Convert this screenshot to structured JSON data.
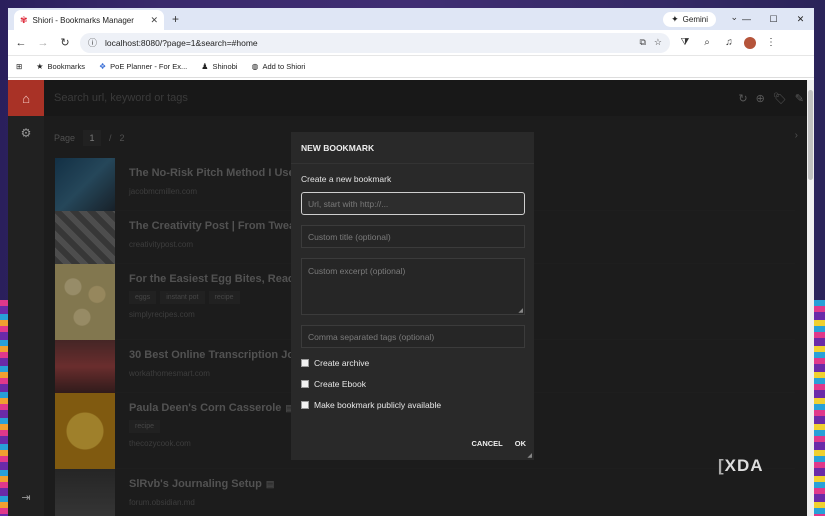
{
  "browser": {
    "tab_title": "Shiori - Bookmarks Manager",
    "gemini_label": "Gemini",
    "url": "localhost:8080/?page=1&search=#home"
  },
  "bookmarks_bar": [
    {
      "label": "Bookmarks",
      "icon": "star-icon"
    },
    {
      "label": "PoE Planner - For Ex...",
      "icon": "poe-icon"
    },
    {
      "label": "Shinobi",
      "icon": "shinobi-icon"
    },
    {
      "label": "Add to Shiori",
      "icon": "globe-icon"
    }
  ],
  "app": {
    "search_placeholder": "Search url, keyword or tags",
    "pager": {
      "label": "Page",
      "current": "1",
      "separator": "/",
      "total": "2"
    }
  },
  "bookmarks": [
    {
      "title": "The No-Risk Pitch Method I Used",
      "domain": "jacobmcmillen.com",
      "tags": []
    },
    {
      "title": "The Creativity Post | From Tweak",
      "domain": "creativitypost.com",
      "tags": []
    },
    {
      "title": "For the Easiest Egg Bites, Reach f",
      "domain": "simplyrecipes.com",
      "tags": [
        "eggs",
        "instant pot",
        "recipe"
      ]
    },
    {
      "title": "30 Best Online Transcription Job",
      "domain": "workathomesmart.com",
      "tags": []
    },
    {
      "title": "Paula Deen's Corn Casserole",
      "domain": "thecozycook.com",
      "tags": [
        "recipe"
      ]
    },
    {
      "title": "SlRvb's Journaling Setup",
      "domain": "forum.obsidian.md",
      "tags": []
    }
  ],
  "modal": {
    "header": "NEW BOOKMARK",
    "subtitle": "Create a new bookmark",
    "url_placeholder": "Url, start with http://...",
    "title_placeholder": "Custom title (optional)",
    "excerpt_placeholder": "Custom excerpt (optional)",
    "tags_placeholder": "Comma separated tags (optional)",
    "checkboxes": [
      "Create archive",
      "Create Ebook",
      "Make bookmark publicly available"
    ],
    "cancel_label": "CANCEL",
    "ok_label": "OK"
  },
  "watermark": "XDA"
}
